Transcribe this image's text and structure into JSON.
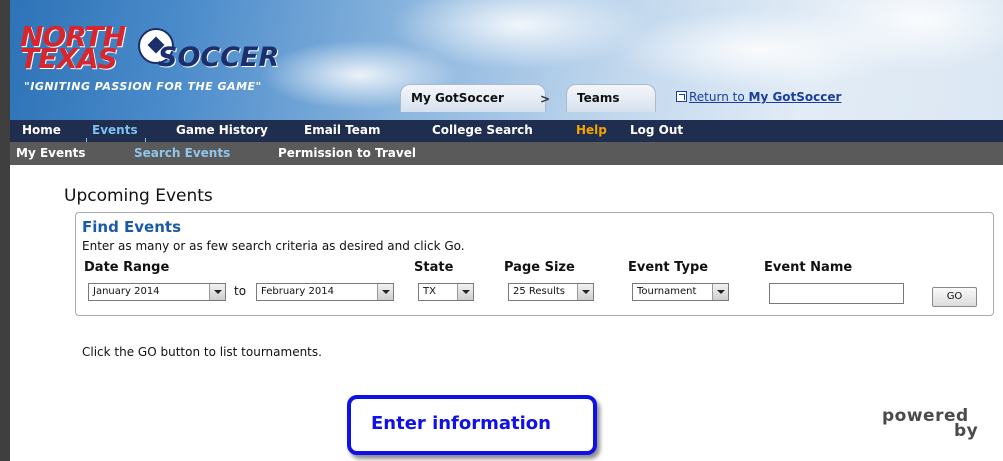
{
  "branding": {
    "logo_line1": "NORTH",
    "logo_line2": "TEXAS",
    "logo_line3": "SOCCER",
    "tagline": "\"IGNITING PASSION FOR THE GAME\""
  },
  "breadcrumb": {
    "items": [
      "My GotSoccer",
      "Teams"
    ],
    "separator": ">",
    "return_prefix": "Return to ",
    "return_bold": "My GotSoccer"
  },
  "nav_primary": {
    "items": [
      "Home",
      "Events",
      "Game History",
      "Email Team",
      "College Search",
      "Help",
      "Log Out"
    ],
    "active": "Events"
  },
  "nav_secondary": {
    "items": [
      "My Events",
      "Search Events",
      "Permission to Travel"
    ],
    "active": "Search Events"
  },
  "page": {
    "title": "Upcoming Events"
  },
  "find_events": {
    "heading": "Find Events",
    "instructions": "Enter as many or as few search criteria as desired and click Go.",
    "labels": {
      "date_range": "Date Range",
      "state": "State",
      "page_size": "Page Size",
      "event_type": "Event Type",
      "event_name": "Event Name"
    },
    "date_from": "January 2014",
    "to_label": "to",
    "date_to": "February 2014",
    "state": "TX",
    "page_size": "25 Results",
    "event_type": "Tournament",
    "event_name": "",
    "go_label": "GO"
  },
  "hint": "Click the GO button to list tournaments.",
  "callout": "Enter information",
  "powered_by": {
    "line1": "powered",
    "line2": "by"
  },
  "colors": {
    "nav_primary_bg": "#1f2d4f",
    "nav_secondary_bg": "#5a5a5a",
    "active_nav": "#7fc0ee",
    "help": "#f6a400",
    "heading_blue": "#1a5aa6",
    "callout_blue": "#1010e8"
  }
}
